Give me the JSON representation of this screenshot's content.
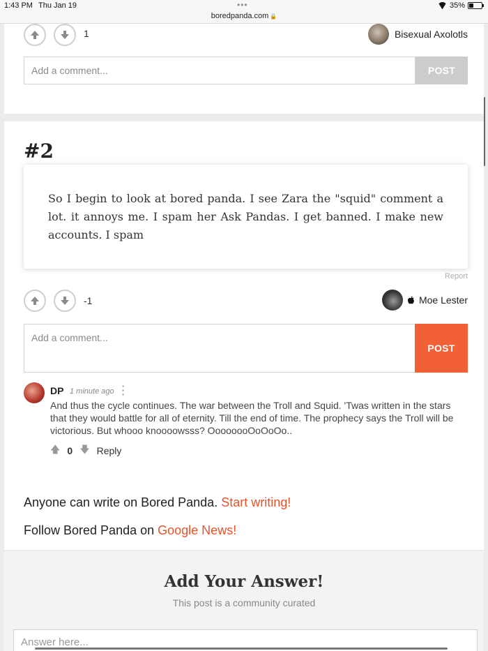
{
  "status_bar": {
    "time": "1:43 PM",
    "date": "Thu Jan 19",
    "url": "boredpanda.com",
    "battery": "35%",
    "battery_level": 0.35
  },
  "entry1": {
    "score": "1",
    "author": "Bisexual Axolotls",
    "comment_placeholder": "Add a comment...",
    "post_label": "POST"
  },
  "entry2": {
    "rank": "#2",
    "text": "So I begin to look at bored panda. I see Zara the \"squid\" comment a lot. it annoys me. I spam her Ask Pandas. I get banned. I make new accounts. I spam",
    "report_label": "Report",
    "score": "-1",
    "author": "Moe Lester",
    "author_icon": "apple-icon",
    "comment_placeholder": "Add a comment...",
    "post_label": "POST"
  },
  "comment": {
    "author": "DP",
    "time": "1 minute ago",
    "text": "And thus the cycle continues. The war between the Troll and Squid. 'Twas written in the stars that they would battle for all of eternity. Till the end of time. The prophecy says the Troll will be victorious. But whooo knoooowsss? OooooooOoOoOo..",
    "votes": "0",
    "reply_label": "Reply"
  },
  "footer": {
    "write_text": "Anyone can write on Bored Panda.",
    "write_link": "Start writing!",
    "follow_text": "Follow Bored Panda on",
    "follow_link": "Google News!"
  },
  "answer": {
    "title": "Add Your Answer!",
    "subtitle": "This post is a community curated",
    "placeholder": "Answer here..."
  },
  "colors": {
    "accent": "#f26135",
    "link": "#e8542a",
    "post_disabled": "#cccccc"
  }
}
